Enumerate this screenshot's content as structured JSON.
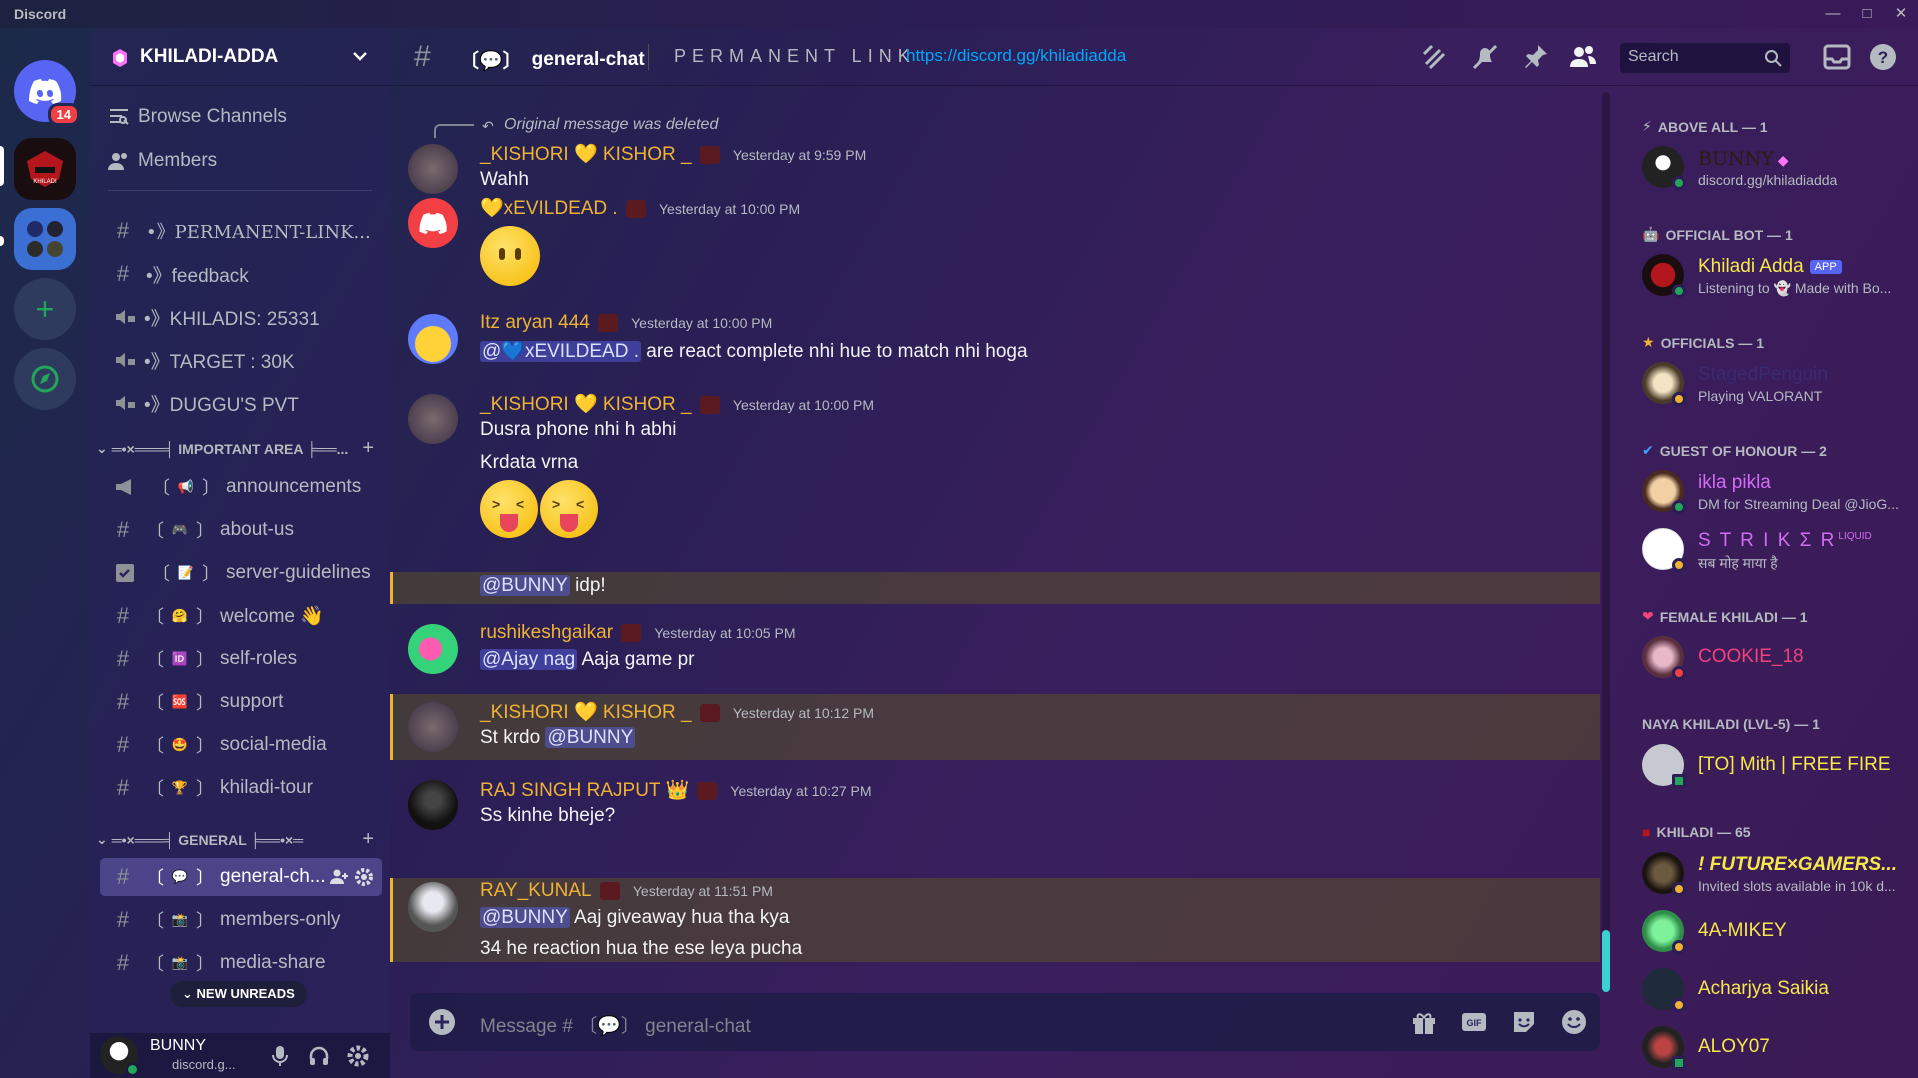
{
  "window": {
    "title": "Discord"
  },
  "rail": {
    "dm_badge": "14"
  },
  "guild": {
    "name": "KHILADI-ADDA"
  },
  "sidebar": {
    "nav": [
      {
        "label": "Browse Channels"
      },
      {
        "label": "Members"
      }
    ],
    "top_channels": [
      {
        "label": "•》PERMANENT-LINK...",
        "type": "text"
      },
      {
        "label": "•》feedback",
        "type": "text"
      },
      {
        "label": "•》KHILADIS: 25331",
        "type": "voice"
      },
      {
        "label": "•》TARGET : 30K",
        "type": "voice"
      },
      {
        "label": "•》DUGGU'S PVT",
        "type": "voice"
      }
    ],
    "categories": [
      {
        "label": "═•×═══╡ IMPORTANT AREA ╞══...",
        "channels": [
          {
            "label": "announcements",
            "emoji": "📢"
          },
          {
            "label": "about-us",
            "emoji": "🎮"
          },
          {
            "label": "server-guidelines",
            "emoji": "📝"
          },
          {
            "label": "welcome 👋",
            "emoji": "🤗"
          },
          {
            "label": "self-roles",
            "emoji": "🆔"
          },
          {
            "label": "support",
            "emoji": "🆘"
          },
          {
            "label": "social-media",
            "emoji": "🤩"
          },
          {
            "label": "khiladi-tour",
            "emoji": "🏆"
          }
        ]
      },
      {
        "label": "═•×═══╡ GENERAL ╞══•×═",
        "channels": [
          {
            "label": "general-ch...",
            "emoji": "💬",
            "active": true
          },
          {
            "label": "members-only",
            "emoji": "📸"
          },
          {
            "label": "media-share",
            "emoji": "📸"
          }
        ]
      }
    ],
    "new_unreads": "NEW UNREADS"
  },
  "user": {
    "name": "BUNNY",
    "status": "discord.g..."
  },
  "header": {
    "channel_name": "general-chat",
    "topic_prefix": "PERMANENT LINK",
    "topic_link": "https://discord.gg/khiladiadda",
    "search_placeholder": "Search"
  },
  "messages": [
    {
      "reply_note": "Original message was deleted",
      "author": "_KISHORI 💛 KISHOR _",
      "color": "#f0b232",
      "time": "Yesterday at 9:59 PM",
      "lines": [
        "Wahh"
      ]
    },
    {
      "author": "💛xEVILDEAD .",
      "color": "#f0b232",
      "time": "Yesterday at 10:00 PM",
      "lines": []
    },
    {
      "author": "Itz aryan 444",
      "color": "#f0b232",
      "time": "Yesterday at 10:00 PM",
      "mention": "@💙xEVILDEAD .",
      "lines": [
        "are react complete nhi hue to match nhi hoga"
      ]
    },
    {
      "author": "_KISHORI 💛 KISHOR _",
      "color": "#f0b232",
      "time": "Yesterday at 10:00 PM",
      "lines": [
        "Dusra phone nhi h abhi",
        "Krdata vrna"
      ],
      "mention_line": "@BUNNY",
      "mention_text": "idp!"
    },
    {
      "author": "rushikeshgaikar",
      "color": "#f0b232",
      "time": "Yesterday at 10:05 PM",
      "mention": "@Ajay nag",
      "lines": [
        "Aaja game pr"
      ]
    },
    {
      "author": "_KISHORI 💛 KISHOR _",
      "color": "#f0b232",
      "time": "Yesterday at 10:12 PM",
      "lines": [
        "St krdo"
      ],
      "mention": "@BUNNY"
    },
    {
      "author": "RAJ SINGH RAJPUT 👑",
      "color": "#f0b232",
      "time": "Yesterday at 10:27 PM",
      "lines": [
        "Ss kinhe bheje?"
      ]
    },
    {
      "author": "RAY_KUNAL",
      "color": "#f0b232",
      "time": "Yesterday at 11:51 PM",
      "mention": "@BUNNY",
      "lines": [
        "Aaj giveaway hua tha kya",
        "34 he reaction hua the ese leya pucha"
      ]
    }
  ],
  "composer": {
    "placeholder": "Message # 〔💬〕 general-chat"
  },
  "member_list": [
    {
      "category": "ABOVE ALL — 1",
      "members": [
        {
          "name": "BUNNY",
          "sub": "discord.gg/khiladiadda",
          "color": "#2b1c10"
        }
      ]
    },
    {
      "category": "OFFICIAL BOT — 1",
      "members": [
        {
          "name": "Khiladi Adda",
          "app_badge": "APP",
          "sub": "Listening to 👻 Made with Bo...",
          "color": "#f5e84a"
        }
      ]
    },
    {
      "category": "OFFICIALS — 1",
      "members": [
        {
          "name": "StagedPenguin",
          "sub": "Playing VALORANT",
          "color": "#3a2a70"
        }
      ]
    },
    {
      "category": "GUEST OF HONOUR — 2",
      "members": [
        {
          "name": "ikla pikla",
          "sub": "DM for Streaming Deal @JioG...",
          "color": "#d36bf4"
        },
        {
          "name": "S T R I K Σ R",
          "name_suffix": "LIQUID",
          "sub": "सब मोह माया है",
          "color": "#d36bf4"
        }
      ]
    },
    {
      "category": "FEMALE KHILADI — 1",
      "members": [
        {
          "name": "COOKIE_18",
          "sub": "",
          "color": "#f0427b"
        }
      ]
    },
    {
      "category": "NAYA KHILADI (LVL-5) — 1",
      "members": [
        {
          "name": "[TO] Mith | FREE FIRE",
          "sub": "",
          "color": "#f5e84a"
        }
      ]
    },
    {
      "category": "KHILADI — 65",
      "members": [
        {
          "name": "! FUTURE×GAMERS...",
          "sub": "Invited slots available in 10k d...",
          "color": "#f5e84a"
        },
        {
          "name": "4A-MIKEY",
          "sub": "",
          "color": "#f5e84a"
        },
        {
          "name": "Acharjya Saikia",
          "sub": "",
          "color": "#f5e84a"
        },
        {
          "name": "ALOY07",
          "sub": "",
          "color": "#f5e84a"
        }
      ]
    }
  ]
}
